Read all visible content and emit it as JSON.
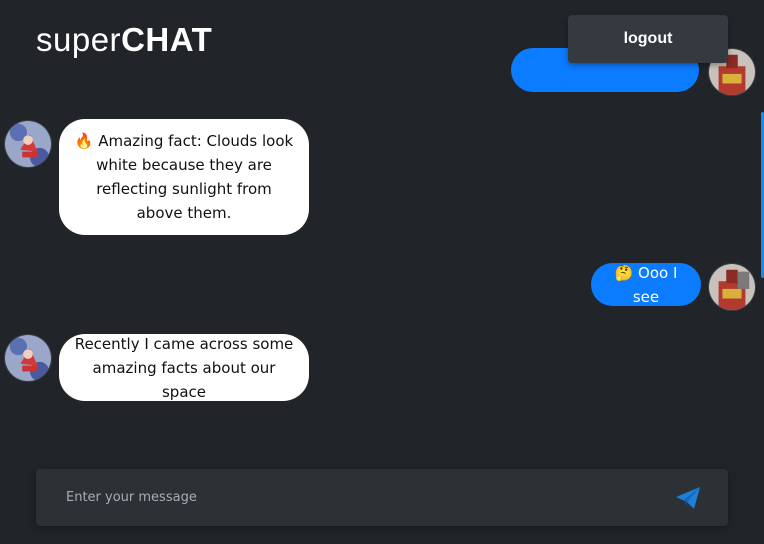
{
  "header": {
    "logo_light": "super",
    "logo_bold": "CHAT",
    "logout_label": "logout"
  },
  "messages": [
    {
      "type": "sent",
      "text": "",
      "partially_hidden": true
    },
    {
      "type": "received",
      "text": "🔥 Amazing fact: Clouds look white because they are reflecting sunlight from above them."
    },
    {
      "type": "sent",
      "text": "🤔 Ooo I see"
    },
    {
      "type": "received",
      "text": "Recently I came across some amazing facts about our space"
    }
  ],
  "composer": {
    "placeholder": "Enter your message",
    "value": "",
    "send_icon": "paper-plane-icon"
  },
  "colors": {
    "background": "#212529",
    "sent_bubble": "#0b7bff",
    "received_bubble": "#ffffff",
    "button": "#343a40",
    "accent": "#1e88e5"
  }
}
